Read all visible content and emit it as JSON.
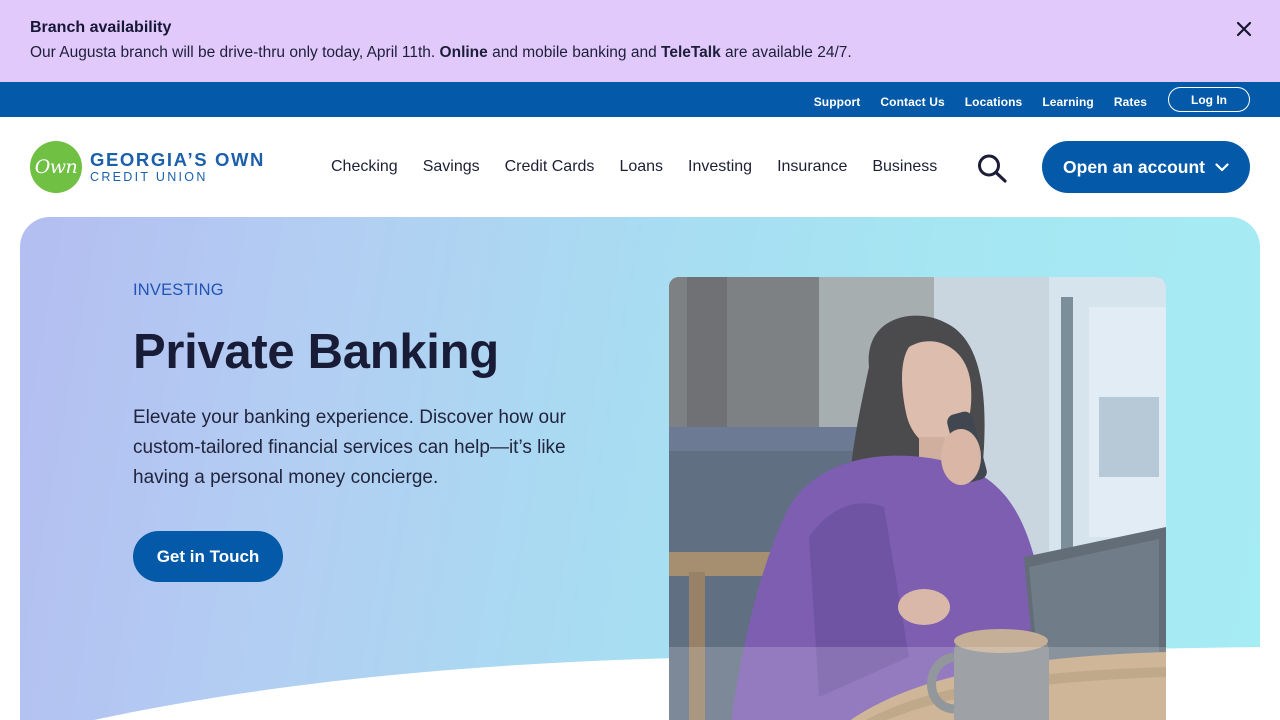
{
  "alert": {
    "title": "Branch availability",
    "message_part1": "Our Augusta branch will be drive-thru only today, April 11th. ",
    "message_bold1": "Online",
    "message_part2": " and mobile banking and ",
    "message_bold2": "TeleTalk",
    "message_part3": " are available 24/7.",
    "close_icon": "close-icon"
  },
  "utility_nav": {
    "links": [
      "Support",
      "Contact Us",
      "Locations",
      "Learning",
      "Rates"
    ],
    "login_label": "Log In"
  },
  "brand": {
    "logo_mark": "Own",
    "name_line1": "GEORGIA’S OWN",
    "name_line2": "CREDIT UNION"
  },
  "main_nav": {
    "items": [
      "Checking",
      "Savings",
      "Credit Cards",
      "Loans",
      "Investing",
      "Insurance",
      "Business"
    ],
    "search_icon": "search-icon",
    "open_account_label": "Open an account",
    "open_account_icon": "chevron-down-icon"
  },
  "hero": {
    "eyebrow": "INVESTING",
    "title": "Private Banking",
    "description": "Elevate your banking experience. Discover how our custom-tailored financial services can help—it’s like having a personal money concierge.",
    "cta_label": "Get in Touch"
  },
  "colors": {
    "alert_bg": "#e2c9fb",
    "primary_blue": "#045aa8",
    "logo_green": "#6fc043",
    "eyebrow_blue": "#2154b5"
  }
}
